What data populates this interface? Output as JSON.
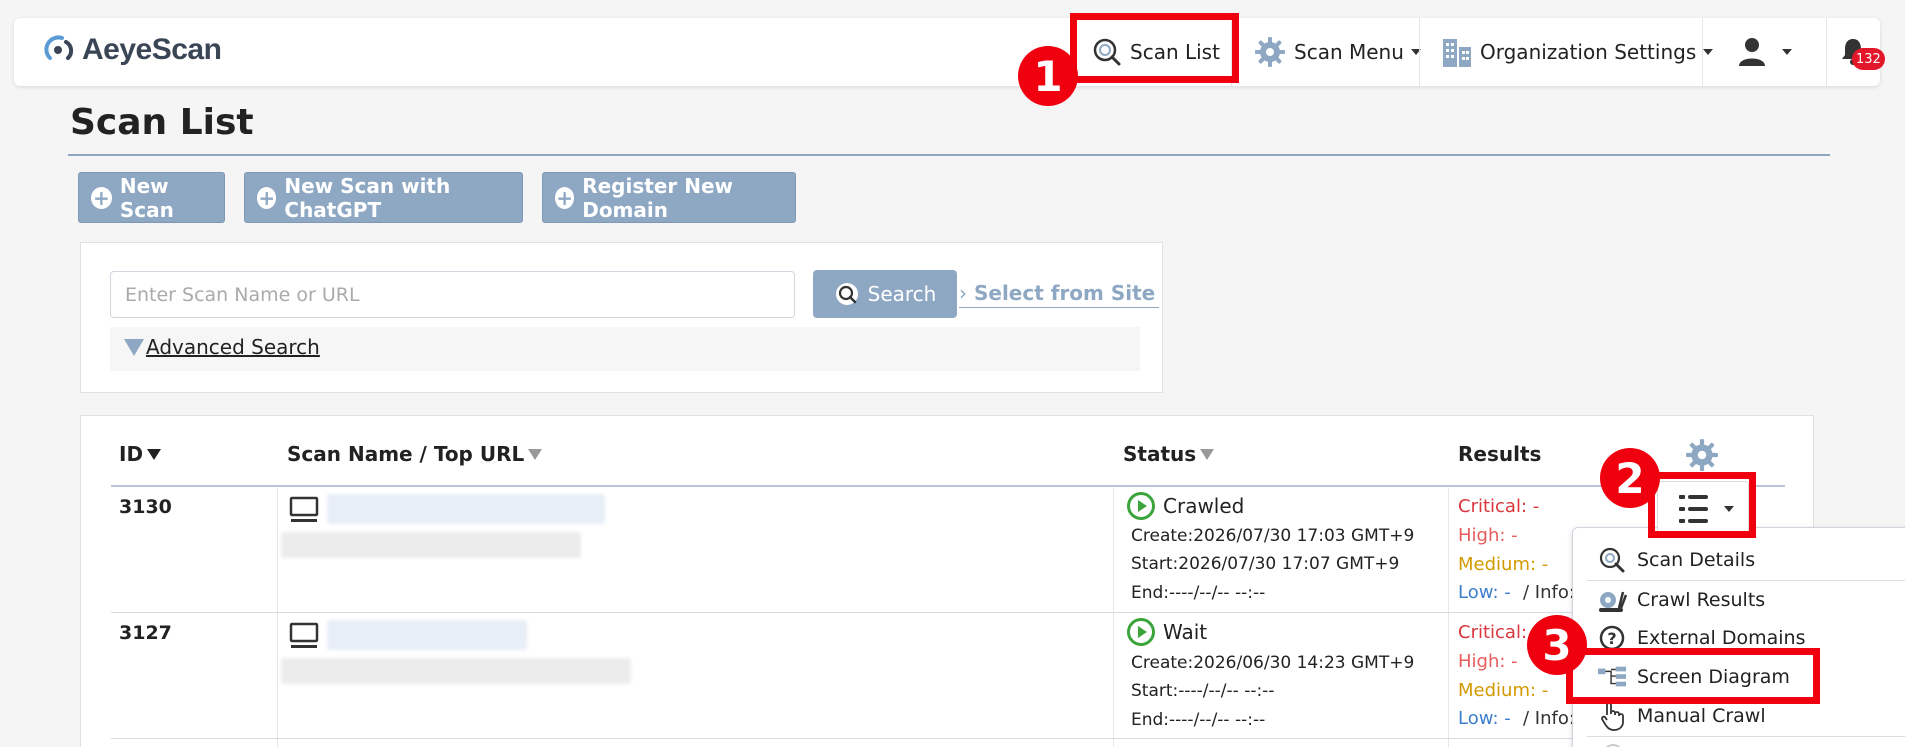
{
  "app": {
    "logo_text": "AeyeScan"
  },
  "navbar": {
    "scan_list": "Scan List",
    "scan_menu": "Scan Menu",
    "org_settings": "Organization Settings",
    "notification_count": "132"
  },
  "page": {
    "title": "Scan List"
  },
  "actions": {
    "new_scan": "New Scan",
    "new_scan_chatgpt": "New Scan with ChatGPT",
    "register_domain": "Register New Domain"
  },
  "search": {
    "placeholder": "Enter Scan Name or URL",
    "button": "Search",
    "select_from_site": "Select from Site",
    "advanced": "Advanced Search"
  },
  "table": {
    "headers": {
      "id": "ID",
      "name": "Scan Name / Top URL",
      "status": "Status",
      "results": "Results"
    },
    "rows": [
      {
        "id": "3130",
        "status": "Crawled",
        "create": "Create:2026/07/30 17:03 GMT+9",
        "start": "Start:2026/07/30 17:07 GMT+9",
        "end": "End:----/--/-- --:--",
        "critical": "Critical: -",
        "high": "High: -",
        "medium": "Medium: -",
        "low": "Low: -",
        "info": "/ Info:"
      },
      {
        "id": "3127",
        "status": "Wait",
        "create": "Create:2026/06/30 14:23 GMT+9",
        "start": "Start:----/--/-- --:--",
        "end": "End:----/--/-- --:--",
        "critical": "Critical:",
        "high": "High: -",
        "medium": "Medium: -",
        "low": "Low: -",
        "info": "/ Info:"
      }
    ]
  },
  "dropdown": {
    "items": [
      "Scan Details",
      "Crawl Results",
      "External Domains",
      "Screen Diagram",
      "Manual Crawl"
    ]
  },
  "annotations": {
    "one": "1",
    "two": "2",
    "three": "3"
  },
  "colors": {
    "accent": "#8ea8c3",
    "annotation_red": "#f0000f",
    "critical": "#d9363e",
    "medium": "#d39a00",
    "low": "#3d7ecc"
  }
}
